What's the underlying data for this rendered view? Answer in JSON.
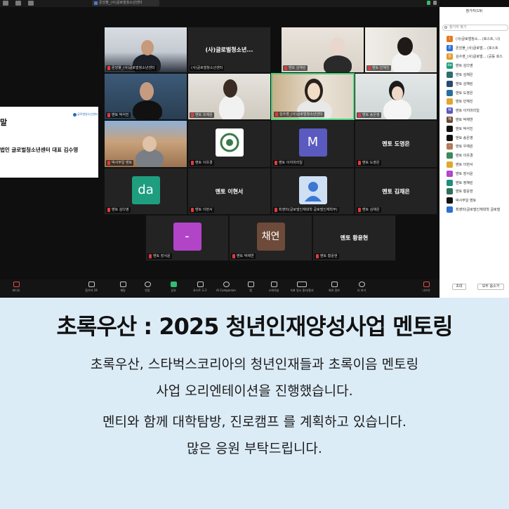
{
  "zoom": {
    "window_tab": "온앙플_(사)글로벌청소년센터",
    "slide": {
      "logo": "글로벌청소년센터",
      "title": "말",
      "body": "법인 글로벌청소년센터 대표 김수영"
    },
    "tiles": [
      {
        "id": "t1",
        "label": "온앙플_(사)글로벌청소년센터"
      },
      {
        "id": "t2",
        "center": "(사)글로벌청소년...",
        "label": "(사)글로벌청소년센터"
      },
      {
        "id": "t3",
        "label": "멘토 김혜린"
      },
      {
        "id": "t4",
        "label": "멘토 민혜진"
      },
      {
        "id": "t5",
        "label": "멘토 박석진"
      },
      {
        "id": "t6",
        "label": "멘토 조예원"
      },
      {
        "id": "t7",
        "label": "김수영_(사)글로벌청소년센터"
      },
      {
        "id": "t8",
        "label": "멘토 송은영"
      },
      {
        "id": "t9",
        "label": "박사무일 멘토"
      },
      {
        "id": "t10",
        "label": "멘토 이유경"
      },
      {
        "id": "t11",
        "avatar": "M",
        "avatar_color": "#5a5ac0",
        "label": "멘토 이지마리일"
      },
      {
        "id": "t12",
        "center": "멘토 도영은",
        "label": "멘토 도영은"
      },
      {
        "id": "t13",
        "avatar": "da",
        "avatar_color": "#1e9e7e",
        "label": "멘토 김다영"
      },
      {
        "id": "t14",
        "center": "멘토 이현서",
        "label": "멘토 이현서"
      },
      {
        "id": "t15",
        "label": "최영미(글로벌인재대학 글로벌인재학부)"
      },
      {
        "id": "t16",
        "center": "멘토 김채은",
        "label": "멘토 김채은"
      },
      {
        "id": "t17",
        "avatar": "-",
        "avatar_color": "#b244c8",
        "label": "멘토 장서윤"
      },
      {
        "id": "t18",
        "avatar": "채연",
        "avatar_color": "#6e4a3a",
        "label": "멘토 박채연"
      },
      {
        "id": "t19",
        "center": "멘토 황윤현",
        "label": "멘토 황윤현"
      }
    ],
    "toolbar": [
      {
        "label": "비디오",
        "color": "red"
      },
      {
        "label": "참가자",
        "count": "19"
      },
      {
        "label": "채팅"
      },
      {
        "label": "반응"
      },
      {
        "label": "공유",
        "color": "green"
      },
      {
        "label": "호스트 도구"
      },
      {
        "label": "AI Companion"
      },
      {
        "label": "앱"
      },
      {
        "label": "소회의실"
      },
      {
        "label": "녹화 일시 중지/중지"
      },
      {
        "label": "회의 정보"
      },
      {
        "label": "더 보기"
      },
      {
        "label": "나가기",
        "color": "red"
      }
    ],
    "panel": {
      "title": "참가자(19)",
      "search_placeholder": "참가자 찾기",
      "participants": [
        {
          "initial": "(",
          "color": "#e07a1f",
          "name": "(사)글로벌청소... (호스트, 나)"
        },
        {
          "initial": "온",
          "color": "#2f6fd1",
          "name": "온앙플_(사)글로벌... (호스트"
        },
        {
          "initial": "김",
          "color": "#e59a2a",
          "name": "김수영_(사)글로벌... (공동 호스"
        },
        {
          "initial": "da",
          "color": "#1e9e7e",
          "name": "멘토 김다영"
        },
        {
          "initial": "",
          "color": "#2c6e6e",
          "name": "멘토 김채은"
        },
        {
          "initial": "",
          "color": "#2a4b6e",
          "name": "멘토 김혜린"
        },
        {
          "initial": "",
          "color": "#2a6e9e",
          "name": "멘토 도영은"
        },
        {
          "initial": "",
          "color": "#e0a730",
          "name": "멘토 민혜진"
        },
        {
          "initial": "M",
          "color": "#5a5ac0",
          "name": "멘토 이지마리일"
        },
        {
          "initial": "채",
          "color": "#6e4a3a",
          "name": "멘토 박채연"
        },
        {
          "initial": "",
          "color": "#111111",
          "name": "멘토 박석진"
        },
        {
          "initial": "",
          "color": "#111111",
          "name": "멘토 송은영"
        },
        {
          "initial": "-",
          "color": "#b07a5a",
          "name": "멘토 우예원"
        },
        {
          "initial": "",
          "color": "#3a8a5a",
          "name": "멘토 이유경"
        },
        {
          "initial": "",
          "color": "#e0a730",
          "name": "멘토 이현서"
        },
        {
          "initial": "-",
          "color": "#b244c8",
          "name": "멘토 장서윤"
        },
        {
          "initial": "",
          "color": "#1e8e7e",
          "name": "멘토 정혜린"
        },
        {
          "initial": "",
          "color": "#2f6f5a",
          "name": "멘토 황윤현"
        },
        {
          "initial": "",
          "color": "#111111",
          "name": "박사무일 멘토"
        },
        {
          "initial": "",
          "color": "#2f6fd1",
          "name": "최영미(글로벌인재대학 글로벌"
        }
      ],
      "invite_label": "초대",
      "mute_all_label": "모두 음소거"
    }
  },
  "caption": {
    "headline": "초록우산 : 2025 청년인재양성사업 멘토링",
    "lines": [
      "초록우산, 스타벅스코리아의 청년인재들과 초록이음 멘토링",
      "사업 오리엔테이션을 진행했습니다.",
      "멘티와 함께  대학탐방, 진로캠프 를 계획하고 있습니다.",
      "많은 응원 부탁드립니다."
    ]
  }
}
